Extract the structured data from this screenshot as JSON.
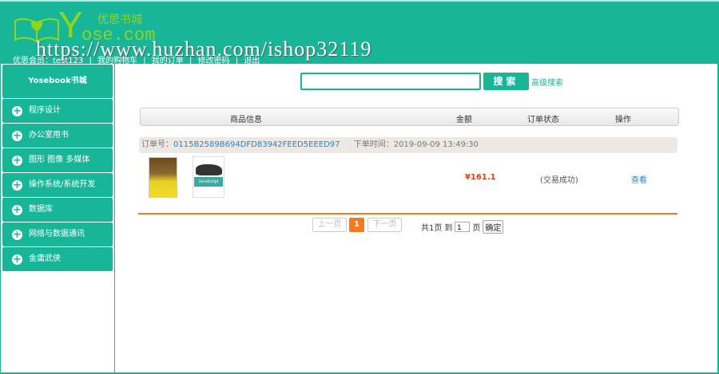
{
  "header": {
    "logo_cn": "优思书城",
    "logo_y": "Y",
    "logo_com": "ose.com",
    "watermark": "https://www.huzhan.com/ishop32119",
    "user_nav": [
      "优思会员：test123",
      "|",
      "我的购物车",
      "|",
      "我的订单",
      "|",
      "修改密码",
      "|",
      "退出"
    ]
  },
  "sidebar": {
    "title": "Yosebook书城",
    "items": [
      {
        "label": "程序设计"
      },
      {
        "label": "办公室用书"
      },
      {
        "label": "图形 图像 多媒体"
      },
      {
        "label": "操作系统/系统开发"
      },
      {
        "label": "数据库"
      },
      {
        "label": "网络与数据通讯"
      },
      {
        "label": "金庸武侠"
      }
    ]
  },
  "search": {
    "value": "",
    "button": "搜索",
    "advanced": "高级搜索"
  },
  "table": {
    "headers": [
      "商品信息",
      "金额",
      "订单状态",
      "操作"
    ]
  },
  "order": {
    "id_label": "订单号：",
    "id": "0115B2589B694DFD83942FEED5EEED97",
    "time_label": "下单时间：",
    "time": "2019-09-09 13:49:30",
    "book2_cover_text": "JavaScript",
    "price": "¥161.1",
    "status": "(交易成功)",
    "action": "查看"
  },
  "pagination": {
    "prev": "上一页",
    "current": "1",
    "next": "下一页",
    "total": "共1页",
    "goto": "到",
    "page_value": "1",
    "page_unit": "页",
    "ok": "确定"
  },
  "colors": {
    "brand": "#17b699",
    "accent": "#f47a20",
    "link": "#1e88c8",
    "price": "#d8421a"
  }
}
